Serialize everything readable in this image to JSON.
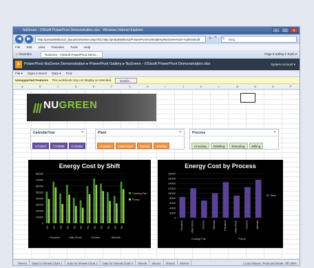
{
  "browser": {
    "title": "NuGreen - OSIsoft PowerPivot Demonstration.xlsx - Windows Internet Explorer",
    "url": "http://pmbah60bos2/_layouts/xlviewer.aspx?id=http://pmbah60bos2/PowerPivot%20Gallery/NuGreen%20-%20OSIsoft",
    "search_placeholder": "Bing",
    "menu": [
      "File",
      "Edit",
      "View",
      "Favorites",
      "Tools",
      "Help"
    ],
    "favorites_label": "Favorites",
    "tab_label": "NuGreen - OSIsoft PowerPivot Demo...",
    "tools_right": "Page ▾  Safety ▾  Tools ▾"
  },
  "sharepoint": {
    "breadcrumb": "PowerPivot NuGreen Demonstration ▸ PowerPivot Gallery ▸ NuGreen - OSIsoft PowerPivot Demonstration.xlsx",
    "user": "System Account ▾"
  },
  "xl_toolbar": [
    "File ▾",
    "Open in Excel",
    "Data ▾",
    "Find"
  ],
  "warning": {
    "title": "Unsupported Features",
    "text": "This workbook may not display as intended.",
    "button": "Details..."
  },
  "columns": [
    "A",
    "B",
    "C",
    "D",
    "E",
    "F",
    "G",
    "H",
    "I",
    "J",
    "K",
    "L",
    "M",
    "N",
    "O",
    "P",
    "Q"
  ],
  "banner": {
    "name_white": "NU",
    "name_green": "GREEN"
  },
  "slicers": {
    "year": {
      "title": "CalendarYear",
      "items": [
        "CY2007",
        "CY2008",
        "CY2009"
      ]
    },
    "plant": {
      "title": "Plant",
      "items": [
        "Houston",
        "Little Rock",
        "Tucson",
        "Wichita"
      ]
    },
    "process": {
      "title": "Process",
      "items": [
        "Cracking",
        "Distilling",
        "Extruding",
        "Milling"
      ]
    }
  },
  "chart_data": [
    {
      "type": "bar",
      "title": "Energy Cost by Shift",
      "ylim": [
        0,
        80000
      ],
      "yticks": [
        "80000",
        "70000",
        "60000",
        "50000",
        "40000",
        "30000",
        "20000",
        "10000",
        "0"
      ],
      "groups": [
        "Houston",
        "Little Rock",
        "Tucson",
        "Wichita"
      ],
      "shifts": [
        "Shift 1",
        "Shift 2",
        "Shift 3"
      ],
      "series": [
        {
          "name": "Cooling Fan",
          "color": "#4e8f3a",
          "values": [
            51000,
            67000,
            48000,
            62000,
            41000,
            37000,
            60000,
            72000,
            64000,
            50000,
            44000,
            67000
          ]
        },
        {
          "name": "Pump",
          "color": "#9ecb58",
          "values": [
            39000,
            58000,
            31000,
            46000,
            28000,
            25000,
            47000,
            62000,
            52000,
            36000,
            32000,
            55000
          ]
        }
      ],
      "legend_position": "right"
    },
    {
      "type": "bar",
      "title": "Energy Cost by Process",
      "ylim": [
        0,
        18000
      ],
      "yticks": [
        "18000",
        "16000",
        "14000",
        "12000",
        "10000",
        "8000",
        "6000",
        "4000",
        "2000",
        "0"
      ],
      "categories": [
        "Houston",
        "Little Rock",
        "Tucson",
        "Wichita",
        "Houston",
        "Little Rock",
        "Tucson",
        "Wichita"
      ],
      "group_labels": [
        "Cooling Fan",
        "Pump"
      ],
      "series": [
        {
          "name": "Total",
          "color": "#5a4394",
          "values": [
            8500,
            12000,
            7000,
            10000,
            14500,
            9000,
            12500,
            15500
          ]
        }
      ],
      "legend_position": "right"
    }
  ],
  "sheet_tabs": [
    "Sheet1",
    "Data for Sheet6 Chart 1",
    "Data for Sheet6 Chart 2",
    "Data for Sheet6 Chart 3",
    "Sheet5",
    "Sheet4",
    "Sheet3",
    "Sheet2"
  ],
  "status": "Local intranet | Protected Mode: Off   100%"
}
